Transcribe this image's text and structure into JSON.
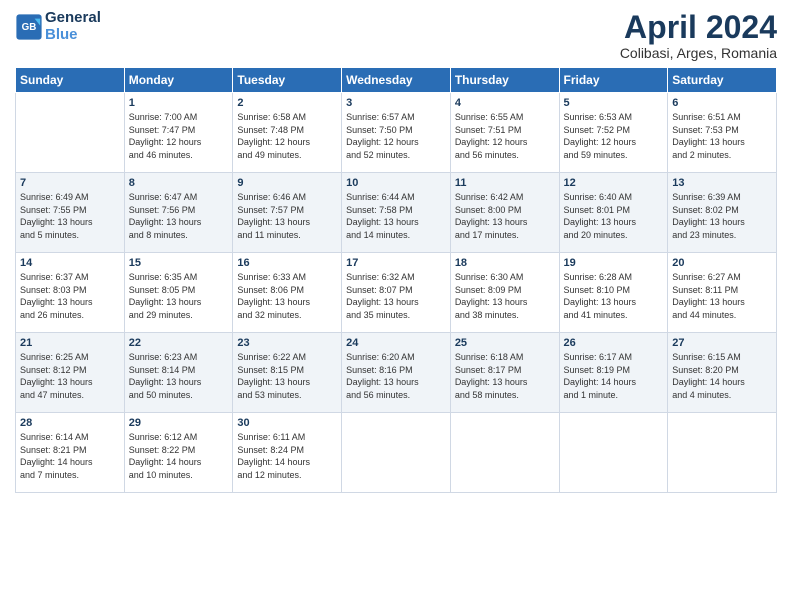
{
  "header": {
    "logo_line1": "General",
    "logo_line2": "Blue",
    "month_title": "April 2024",
    "subtitle": "Colibasi, Arges, Romania"
  },
  "days_of_week": [
    "Sunday",
    "Monday",
    "Tuesday",
    "Wednesday",
    "Thursday",
    "Friday",
    "Saturday"
  ],
  "weeks": [
    [
      {
        "num": "",
        "info": ""
      },
      {
        "num": "1",
        "info": "Sunrise: 7:00 AM\nSunset: 7:47 PM\nDaylight: 12 hours\nand 46 minutes."
      },
      {
        "num": "2",
        "info": "Sunrise: 6:58 AM\nSunset: 7:48 PM\nDaylight: 12 hours\nand 49 minutes."
      },
      {
        "num": "3",
        "info": "Sunrise: 6:57 AM\nSunset: 7:50 PM\nDaylight: 12 hours\nand 52 minutes."
      },
      {
        "num": "4",
        "info": "Sunrise: 6:55 AM\nSunset: 7:51 PM\nDaylight: 12 hours\nand 56 minutes."
      },
      {
        "num": "5",
        "info": "Sunrise: 6:53 AM\nSunset: 7:52 PM\nDaylight: 12 hours\nand 59 minutes."
      },
      {
        "num": "6",
        "info": "Sunrise: 6:51 AM\nSunset: 7:53 PM\nDaylight: 13 hours\nand 2 minutes."
      }
    ],
    [
      {
        "num": "7",
        "info": "Sunrise: 6:49 AM\nSunset: 7:55 PM\nDaylight: 13 hours\nand 5 minutes."
      },
      {
        "num": "8",
        "info": "Sunrise: 6:47 AM\nSunset: 7:56 PM\nDaylight: 13 hours\nand 8 minutes."
      },
      {
        "num": "9",
        "info": "Sunrise: 6:46 AM\nSunset: 7:57 PM\nDaylight: 13 hours\nand 11 minutes."
      },
      {
        "num": "10",
        "info": "Sunrise: 6:44 AM\nSunset: 7:58 PM\nDaylight: 13 hours\nand 14 minutes."
      },
      {
        "num": "11",
        "info": "Sunrise: 6:42 AM\nSunset: 8:00 PM\nDaylight: 13 hours\nand 17 minutes."
      },
      {
        "num": "12",
        "info": "Sunrise: 6:40 AM\nSunset: 8:01 PM\nDaylight: 13 hours\nand 20 minutes."
      },
      {
        "num": "13",
        "info": "Sunrise: 6:39 AM\nSunset: 8:02 PM\nDaylight: 13 hours\nand 23 minutes."
      }
    ],
    [
      {
        "num": "14",
        "info": "Sunrise: 6:37 AM\nSunset: 8:03 PM\nDaylight: 13 hours\nand 26 minutes."
      },
      {
        "num": "15",
        "info": "Sunrise: 6:35 AM\nSunset: 8:05 PM\nDaylight: 13 hours\nand 29 minutes."
      },
      {
        "num": "16",
        "info": "Sunrise: 6:33 AM\nSunset: 8:06 PM\nDaylight: 13 hours\nand 32 minutes."
      },
      {
        "num": "17",
        "info": "Sunrise: 6:32 AM\nSunset: 8:07 PM\nDaylight: 13 hours\nand 35 minutes."
      },
      {
        "num": "18",
        "info": "Sunrise: 6:30 AM\nSunset: 8:09 PM\nDaylight: 13 hours\nand 38 minutes."
      },
      {
        "num": "19",
        "info": "Sunrise: 6:28 AM\nSunset: 8:10 PM\nDaylight: 13 hours\nand 41 minutes."
      },
      {
        "num": "20",
        "info": "Sunrise: 6:27 AM\nSunset: 8:11 PM\nDaylight: 13 hours\nand 44 minutes."
      }
    ],
    [
      {
        "num": "21",
        "info": "Sunrise: 6:25 AM\nSunset: 8:12 PM\nDaylight: 13 hours\nand 47 minutes."
      },
      {
        "num": "22",
        "info": "Sunrise: 6:23 AM\nSunset: 8:14 PM\nDaylight: 13 hours\nand 50 minutes."
      },
      {
        "num": "23",
        "info": "Sunrise: 6:22 AM\nSunset: 8:15 PM\nDaylight: 13 hours\nand 53 minutes."
      },
      {
        "num": "24",
        "info": "Sunrise: 6:20 AM\nSunset: 8:16 PM\nDaylight: 13 hours\nand 56 minutes."
      },
      {
        "num": "25",
        "info": "Sunrise: 6:18 AM\nSunset: 8:17 PM\nDaylight: 13 hours\nand 58 minutes."
      },
      {
        "num": "26",
        "info": "Sunrise: 6:17 AM\nSunset: 8:19 PM\nDaylight: 14 hours\nand 1 minute."
      },
      {
        "num": "27",
        "info": "Sunrise: 6:15 AM\nSunset: 8:20 PM\nDaylight: 14 hours\nand 4 minutes."
      }
    ],
    [
      {
        "num": "28",
        "info": "Sunrise: 6:14 AM\nSunset: 8:21 PM\nDaylight: 14 hours\nand 7 minutes."
      },
      {
        "num": "29",
        "info": "Sunrise: 6:12 AM\nSunset: 8:22 PM\nDaylight: 14 hours\nand 10 minutes."
      },
      {
        "num": "30",
        "info": "Sunrise: 6:11 AM\nSunset: 8:24 PM\nDaylight: 14 hours\nand 12 minutes."
      },
      {
        "num": "",
        "info": ""
      },
      {
        "num": "",
        "info": ""
      },
      {
        "num": "",
        "info": ""
      },
      {
        "num": "",
        "info": ""
      }
    ]
  ]
}
